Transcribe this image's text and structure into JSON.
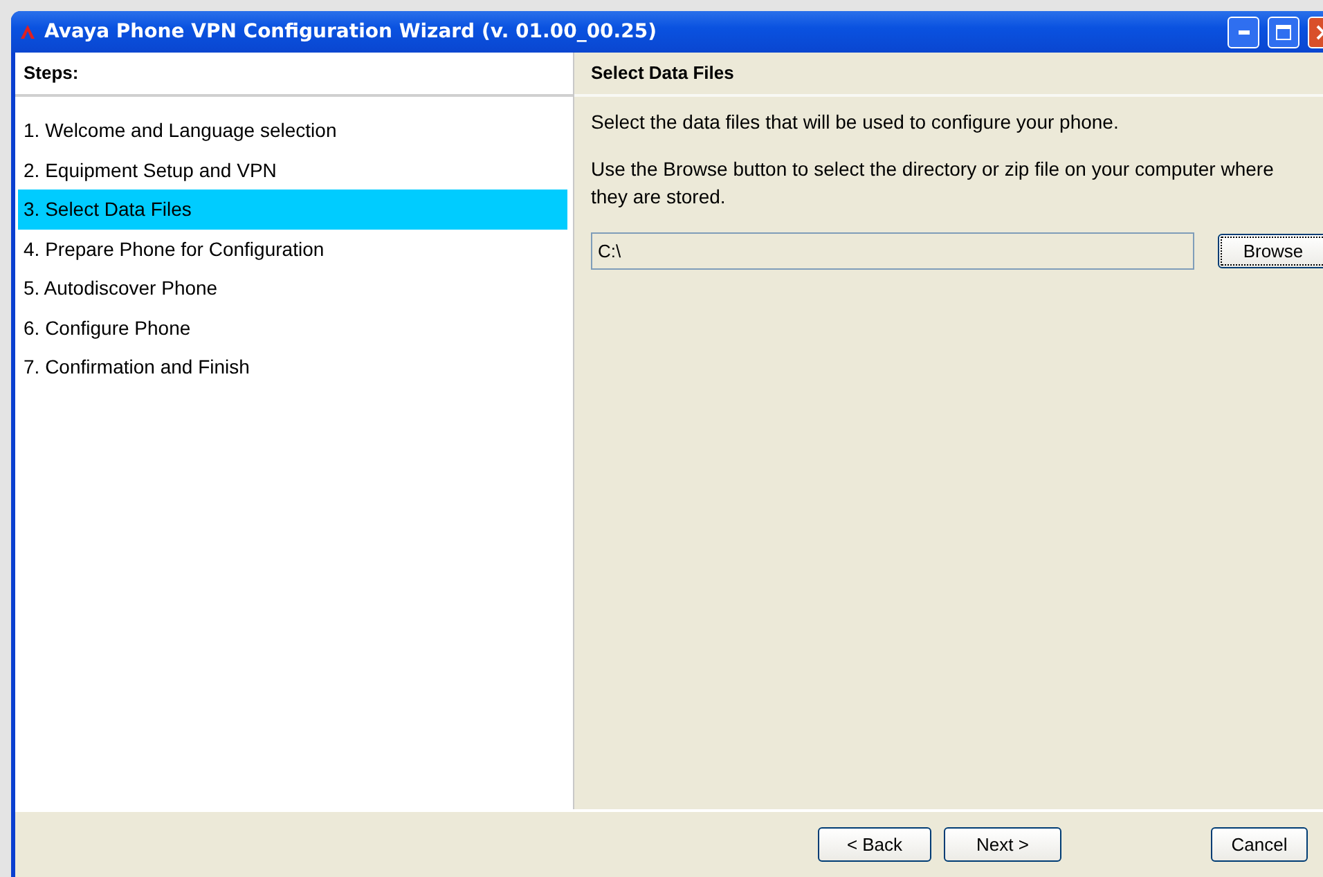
{
  "window": {
    "title": "Avaya Phone VPN Configuration Wizard (v. 01.00_00.25)"
  },
  "steps": {
    "heading": "Steps:",
    "items": [
      {
        "label": "1. Welcome and Language selection",
        "selected": false
      },
      {
        "label": "2. Equipment Setup and VPN",
        "selected": false
      },
      {
        "label": "3. Select Data Files",
        "selected": true
      },
      {
        "label": "4. Prepare Phone for Configuration",
        "selected": false
      },
      {
        "label": "5. Autodiscover Phone",
        "selected": false
      },
      {
        "label": "6. Configure Phone",
        "selected": false
      },
      {
        "label": "7. Confirmation and Finish",
        "selected": false
      }
    ]
  },
  "page": {
    "heading": "Select Data Files",
    "paragraphs": [
      "Select the data files that will be used to configure your phone.",
      "Use the Browse button to select the directory or zip file on your computer where they are stored."
    ],
    "path_field": {
      "value": "C:\\"
    },
    "browse_button": "Browse"
  },
  "buttons": {
    "back": "< Back",
    "next": "Next >",
    "cancel": "Cancel"
  }
}
